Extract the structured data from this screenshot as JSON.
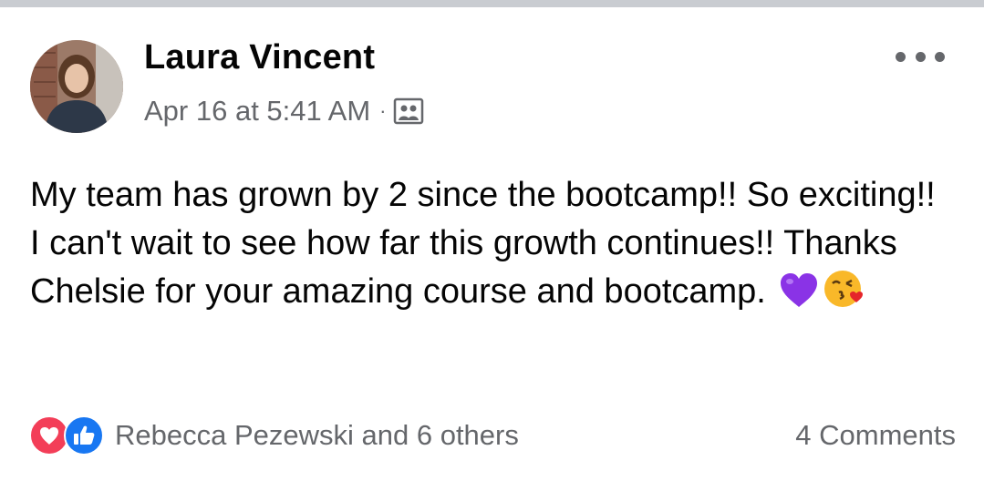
{
  "post": {
    "author": "Laura Vincent",
    "timestamp": "Apr 16 at 5:41 AM",
    "separator": "·",
    "audience_icon": "group-icon",
    "more_icon": "more-options-icon",
    "text": "My team has grown by 2 since the bootcamp!! So exciting!! I can't wait to see how far this growth continues!! Thanks Chelsie for your amazing course and bootcamp.",
    "emojis": [
      "purple-heart-icon",
      "face-blowing-kiss-icon"
    ]
  },
  "footer": {
    "reactions_label": "Rebecca Pezewski and 6 others",
    "reaction_icons": [
      "love-reaction-icon",
      "like-reaction-icon"
    ],
    "comments_label": "4 Comments"
  },
  "colors": {
    "love": "#f33e58",
    "like": "#1877f2",
    "secondary_text": "#65676b",
    "primary_text": "#050505"
  }
}
